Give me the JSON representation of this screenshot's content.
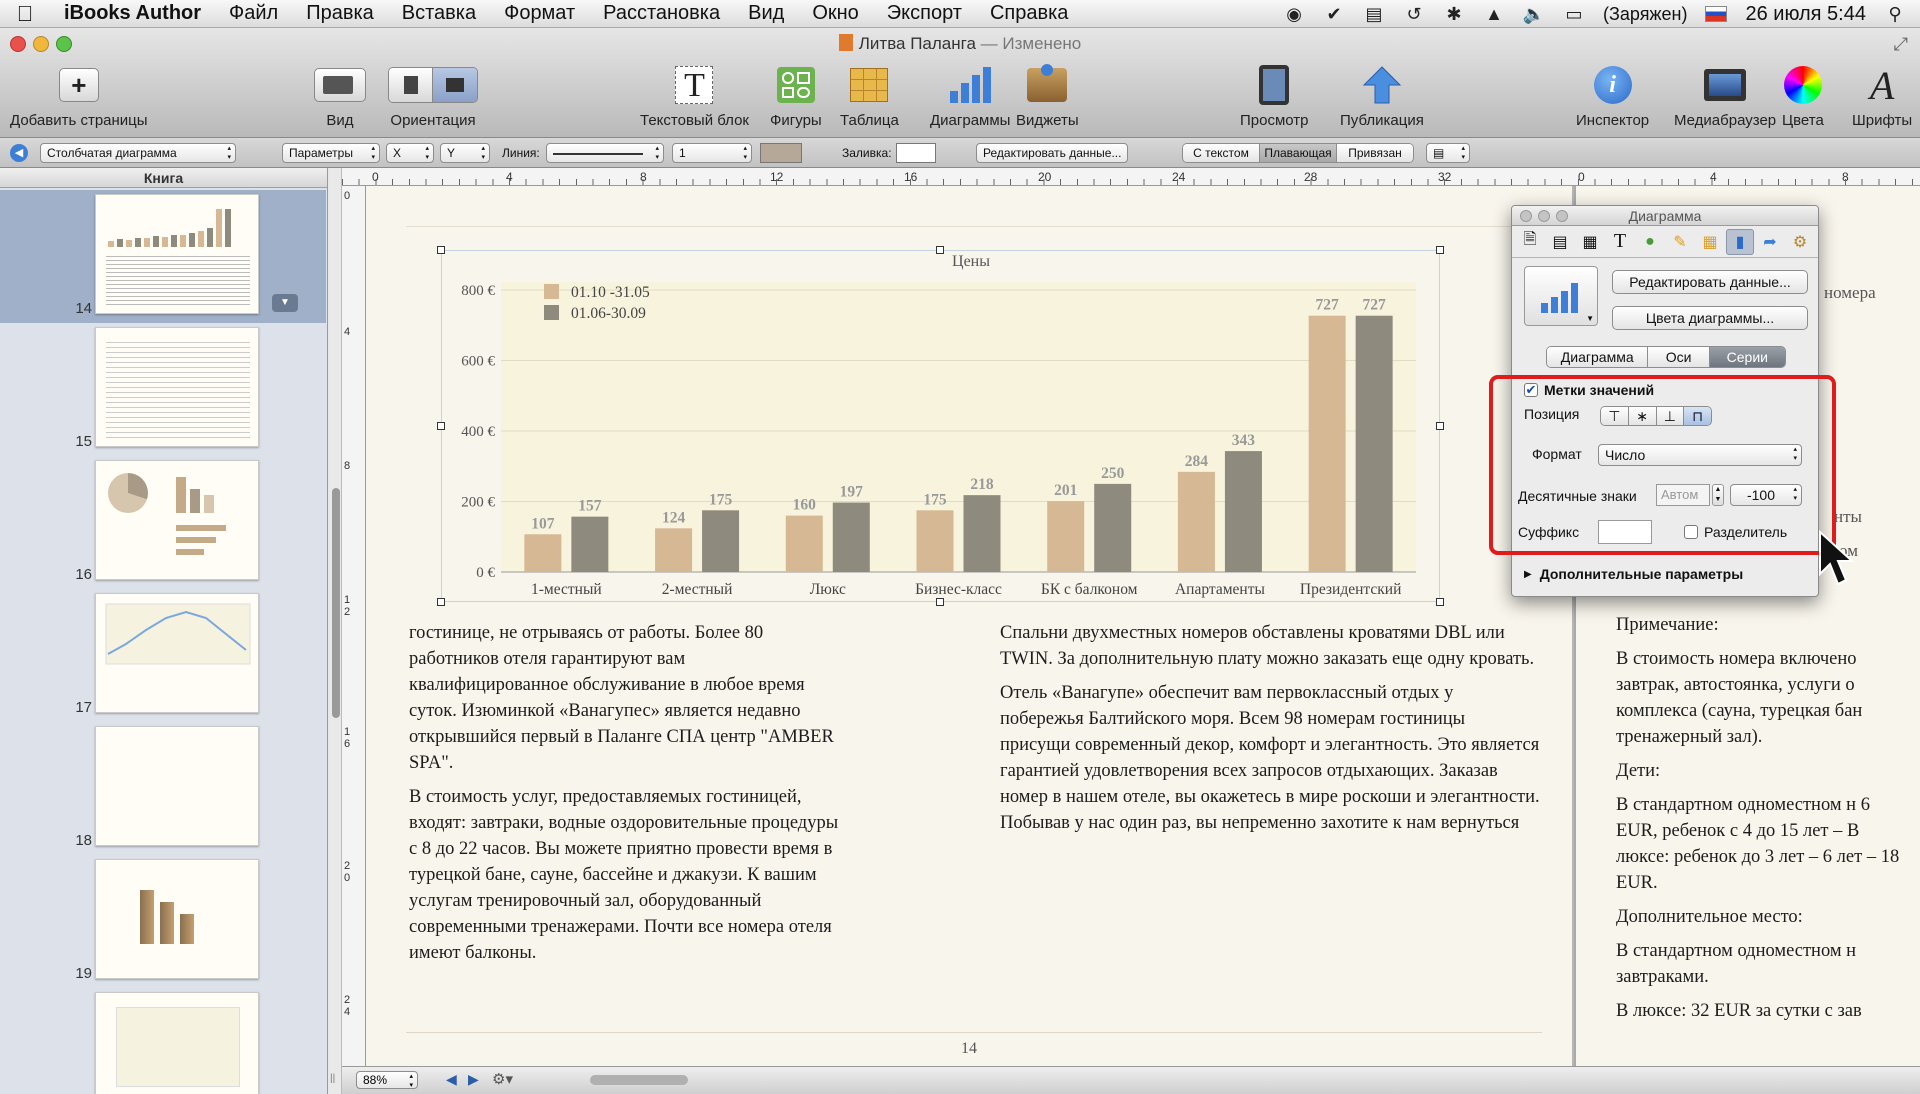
{
  "menubar": {
    "items": [
      "iBooks Author",
      "Файл",
      "Правка",
      "Вставка",
      "Формат",
      "Расстановка",
      "Вид",
      "Окно",
      "Экспорт",
      "Справка"
    ],
    "battery": "(Заряжен)",
    "datetime": "26 июля  5:44"
  },
  "window": {
    "title": "Литва Паланга",
    "edited": "— Изменено"
  },
  "toolbar": {
    "add_pages": "Добавить страницы",
    "view": "Вид",
    "orientation": "Ориентация",
    "textbox": "Текстовый блок",
    "shapes": "Фигуры",
    "table": "Таблица",
    "charts": "Диаграммы",
    "widgets": "Виджеты",
    "preview": "Просмотр",
    "publish": "Публикация",
    "inspector": "Инспектор",
    "media": "Медиабраузер",
    "colors": "Цвета",
    "fonts": "Шрифты"
  },
  "formatbar": {
    "chart_type": "Столбчатая диаграмма",
    "params": "Параметры",
    "x": "X",
    "y": "Y",
    "line_label": "Линия:",
    "line_width": "1",
    "fill_label": "Заливка:",
    "edit_data": "Редактировать данные...",
    "wrap_with_text": "С текстом",
    "wrap_floating": "Плавающая",
    "wrap_anchored": "Привязан"
  },
  "sidebar": {
    "header": "Книга",
    "pages": [
      "14",
      "15",
      "16",
      "17",
      "18",
      "19"
    ]
  },
  "ruler": {
    "top": [
      "0",
      "4",
      "8",
      "12",
      "16",
      "20",
      "24",
      "28",
      "32"
    ],
    "right": [
      "0",
      "4",
      "8"
    ],
    "left": [
      "0",
      "4",
      "8",
      "12",
      "16",
      "20",
      "24"
    ]
  },
  "chart_data": {
    "type": "bar",
    "title": "Цены",
    "categories": [
      "1-местный",
      "2-местный",
      "Люкс",
      "Бизнес-класс",
      "БК с балконом",
      "Апартаменты",
      "Президентский"
    ],
    "series": [
      {
        "name": "01.10 -31.05",
        "values": [
          107,
          124,
          160,
          175,
          201,
          284,
          727
        ],
        "color": "#d6b994"
      },
      {
        "name": "01.06-30.09",
        "values": [
          157,
          175,
          197,
          218,
          250,
          343,
          727
        ],
        "color": "#8f8a7e"
      }
    ],
    "ylim": [
      0,
      800
    ],
    "yticks": [
      "0 €",
      "200 €",
      "400 €",
      "600 €",
      "800 €"
    ],
    "ytick_values": [
      0,
      200,
      400,
      600,
      800
    ],
    "legend": "top-left",
    "grid": true
  },
  "body": {
    "col1": [
      "гостинице, не отрываясь от работы. Более 80 работников отеля гарантируют вам квалифицированное обслуживание в любое время суток. Изюминкой «Ванагупес» является недавно открывшийся первый в Паланге СПА центр \"AMBER SPA\".",
      "В стоимость услуг, предоставляемых гостиницей, входят: завтраки, водные оздоровительные процедуры с 8 до 22 часов. Вы можете приятно провести время в турецкой бане, сауне, бассейне и джакузи. К вашим услугам тренировочный зал, оборудованный современными тренажерами. Почти все номера отеля имеют балконы."
    ],
    "col2": [
      "Спальни двухместных номеров обставлены кроватями DBL или TWIN. За дополнительную плату можно заказать еще одну кровать.",
      "Отель «Ванагупе» обеспечит вам первоклассный отдых у побережья Балтийского моря. Всем 98 номерам гостиницы присущи современный декор, комфорт и элегантность. Это является гарантией удовлетворения всех запросов отдыхающих. Заказав номер  в нашем отеле, вы окажетесь в мире роскоши и элегантности. Побывав у нас один раз, вы непременно захотите к нам вернуться"
    ],
    "page_number": "14",
    "right_frag_top": [
      "номера",
      "нты",
      "угом"
    ],
    "right_col": [
      "Примечание:",
      "В стоимость номера включено завтрак, автостоянка, услуги о комплекса (сауна, турецкая бан тренажерный зал).",
      "Дети:",
      "В стандартном одноместном н 6 EUR, ребенок с 4 до 15 лет – В люксе: ребенок до 3 лет  –  6 лет – 18 EUR.",
      "Дополнительное  место:",
      "В стандартном одноместном н завтраками.",
      "В люксе: 32 EUR за сутки с зав"
    ]
  },
  "inspector": {
    "title": "Диаграмма",
    "edit_data": "Редактировать данные...",
    "chart_colors": "Цвета диаграммы...",
    "tabs": [
      "Диаграмма",
      "Оси",
      "Серии"
    ],
    "value_labels": "Метки значений",
    "position_label": "Позиция",
    "format_label": "Формат",
    "format_value": "Число",
    "decimals_label": "Десятичные знаки",
    "decimals_placeholder": "Автом",
    "decimals_value": "-100",
    "suffix_label": "Суффикс",
    "separator_label": "Разделитель",
    "more": "Дополнительные параметры"
  },
  "statusbar": {
    "zoom": "88%"
  }
}
